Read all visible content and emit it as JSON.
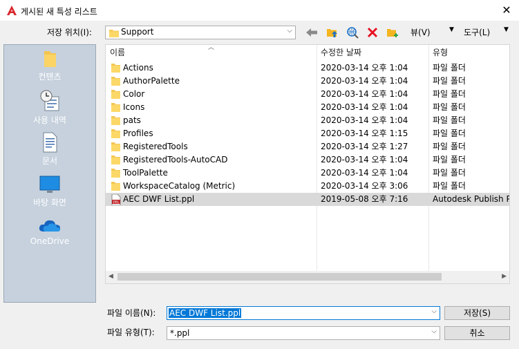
{
  "window": {
    "title": "게시된 새 특성 리스트",
    "close_glyph": "✕"
  },
  "toolbar": {
    "save_in_label": "저장 위치(I):",
    "path": "Support",
    "views_label": "뷰(V)",
    "tools_label": "도구(L)"
  },
  "places": [
    {
      "label": "컨텐츠",
      "icon": "folder-icon"
    },
    {
      "label": "사용 내역",
      "icon": "history-icon"
    },
    {
      "label": "문서",
      "icon": "documents-icon"
    },
    {
      "label": "바탕 화면",
      "icon": "desktop-icon"
    },
    {
      "label": "OneDrive",
      "icon": "onedrive-icon"
    }
  ],
  "columns": {
    "name": "이름",
    "date": "수정한 날짜",
    "type": "유형"
  },
  "files": [
    {
      "name": "Actions",
      "date": "2020-03-14 오후 1:04",
      "type": "파일 폴더",
      "icon": "folder-icon"
    },
    {
      "name": "AuthorPalette",
      "date": "2020-03-14 오후 1:04",
      "type": "파일 폴더",
      "icon": "folder-icon"
    },
    {
      "name": "Color",
      "date": "2020-03-14 오후 1:04",
      "type": "파일 폴더",
      "icon": "folder-icon"
    },
    {
      "name": "Icons",
      "date": "2020-03-14 오후 1:04",
      "type": "파일 폴더",
      "icon": "folder-icon"
    },
    {
      "name": "pats",
      "date": "2020-03-14 오후 1:04",
      "type": "파일 폴더",
      "icon": "folder-icon"
    },
    {
      "name": "Profiles",
      "date": "2020-03-14 오후 1:15",
      "type": "파일 폴더",
      "icon": "folder-icon"
    },
    {
      "name": "RegisteredTools",
      "date": "2020-03-14 오후 1:27",
      "type": "파일 폴더",
      "icon": "folder-icon"
    },
    {
      "name": "RegisteredTools-AutoCAD",
      "date": "2020-03-14 오후 1:04",
      "type": "파일 폴더",
      "icon": "folder-icon"
    },
    {
      "name": "ToolPalette",
      "date": "2020-03-14 오후 1:04",
      "type": "파일 폴더",
      "icon": "folder-icon"
    },
    {
      "name": "WorkspaceCatalog (Metric)",
      "date": "2020-03-14 오후 3:06",
      "type": "파일 폴더",
      "icon": "folder-icon"
    },
    {
      "name": "AEC DWF List.ppl",
      "date": "2019-05-08 오후 7:16",
      "type": "Autodesk Publish Pr...",
      "icon": "ppl-file-icon",
      "selected": true
    }
  ],
  "form": {
    "filename_label": "파일 이름(N):",
    "filename_value": "AEC DWF List.ppl",
    "filetype_label": "파일 유형(T):",
    "filetype_value": "*.ppl",
    "save_button": "저장(S)",
    "cancel_button": "취소"
  },
  "colors": {
    "accent": "#0078d7",
    "places_bg": "#c6d1dd",
    "delete_red": "#e81123"
  }
}
